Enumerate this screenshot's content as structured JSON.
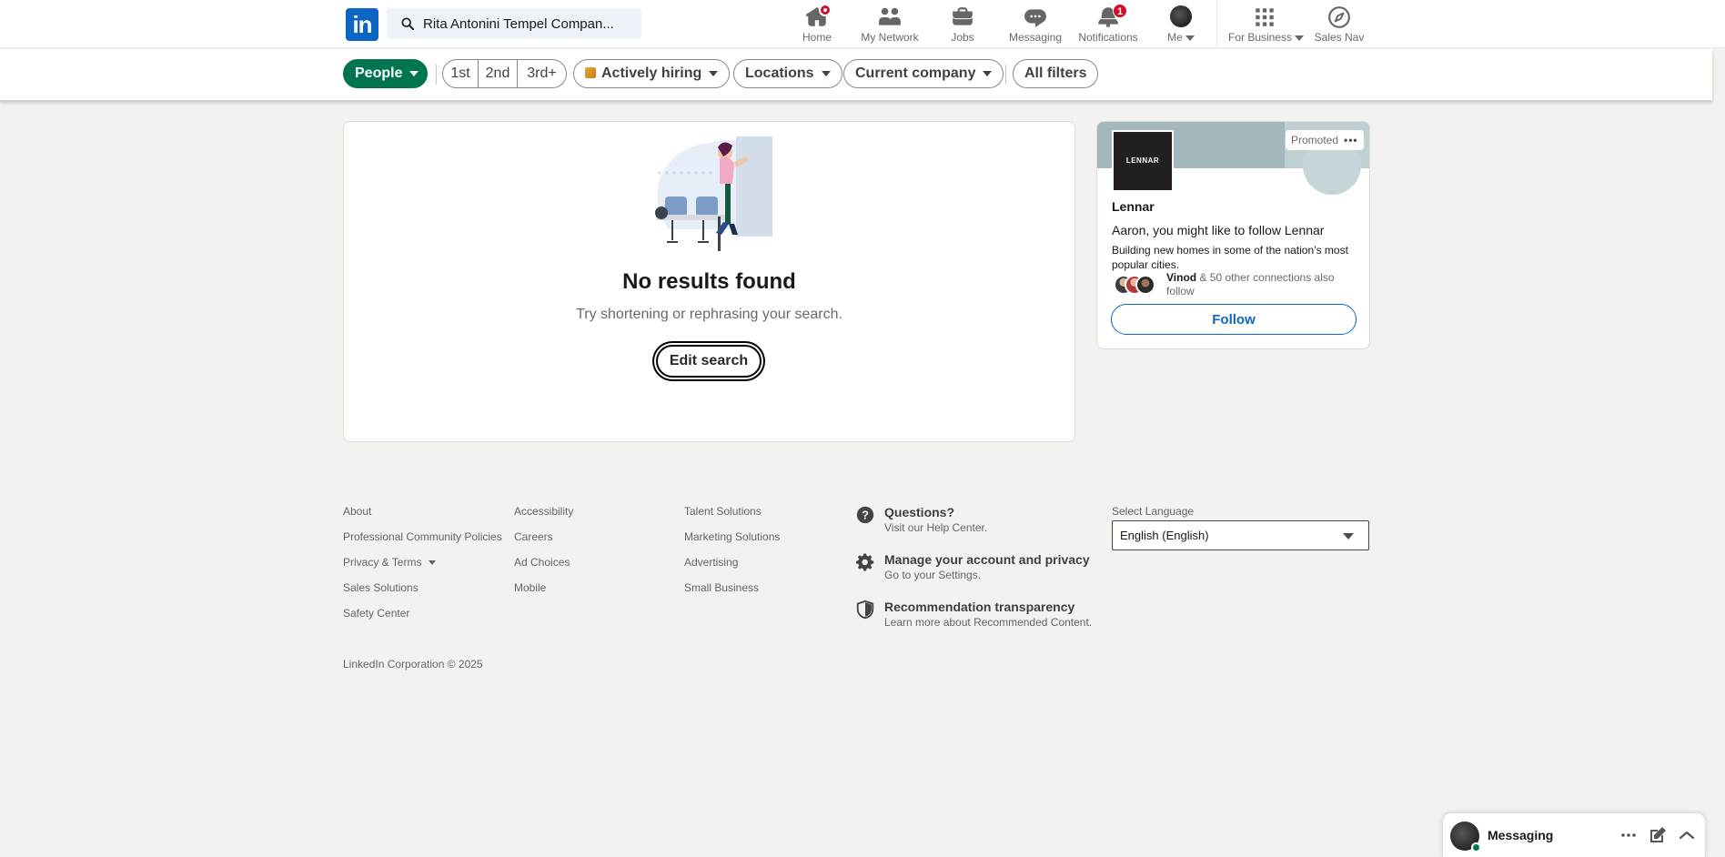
{
  "search": {
    "value": "Rita Antonini Tempel Compan..."
  },
  "nav": {
    "home": "Home",
    "network": "My Network",
    "jobs": "Jobs",
    "messaging": "Messaging",
    "notifications": "Notifications",
    "notifications_count": "1",
    "me": "Me",
    "business": "For Business",
    "salesnav": "Sales Nav"
  },
  "filters": {
    "people": "People",
    "first": "1st",
    "second": "2nd",
    "third": "3rd+",
    "hiring": "Actively hiring",
    "locations": "Locations",
    "company": "Current company",
    "all": "All filters"
  },
  "results": {
    "title": "No results found",
    "subtitle": "Try shortening or rephrasing your search.",
    "edit_button": "Edit search"
  },
  "ad": {
    "promoted": "Promoted",
    "more": "•••",
    "logo_text": "LENNAR",
    "company": "Lennar",
    "pitch": "Aaron, you might like to follow Lennar",
    "description": "Building new homes in some of the nation’s most popular cities.",
    "connection_name": "Vinod",
    "connection_rest": "& 50 other connections also follow",
    "follow": "Follow"
  },
  "footer": {
    "col1": [
      "About",
      "Professional Community Policies",
      "Privacy & Terms",
      "Sales Solutions",
      "Safety Center"
    ],
    "col2": [
      "Accessibility",
      "Careers",
      "Ad Choices",
      "Mobile"
    ],
    "col3": [
      "Talent Solutions",
      "Marketing Solutions",
      "Advertising",
      "Small Business"
    ],
    "help": [
      {
        "title": "Questions?",
        "sub": "Visit our Help Center."
      },
      {
        "title": "Manage your account and privacy",
        "sub": "Go to your Settings."
      },
      {
        "title": "Recommendation transparency",
        "sub": "Learn more about Recommended Content."
      }
    ],
    "language_label": "Select Language",
    "language_value": "English (English)",
    "copyright": "LinkedIn Corporation © 2025"
  },
  "messaging": {
    "title": "Messaging"
  },
  "colors": {
    "brand": "#0a66c2",
    "people_pill": "#01754f",
    "badge": "#cb112d"
  }
}
